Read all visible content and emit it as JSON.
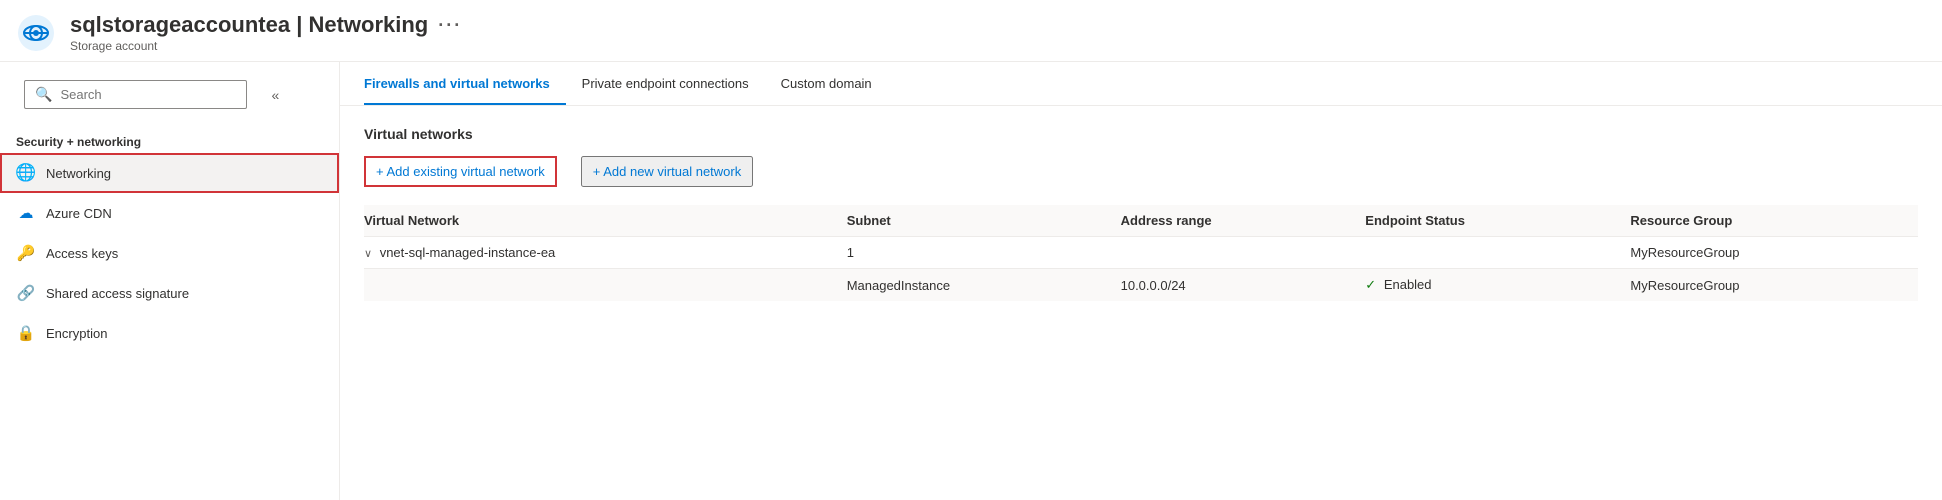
{
  "header": {
    "title": "sqlstorageaccountea | Networking",
    "resource_name": "sqlstorageaccountea",
    "page_name": "Networking",
    "subtitle": "Storage account",
    "dots": "···"
  },
  "sidebar": {
    "search_placeholder": "Search",
    "collapse_icon": "«",
    "section_label": "Security + networking",
    "items": [
      {
        "id": "networking",
        "label": "Networking",
        "icon": "🌐",
        "active": true
      },
      {
        "id": "azure-cdn",
        "label": "Azure CDN",
        "icon": "☁",
        "active": false
      },
      {
        "id": "access-keys",
        "label": "Access keys",
        "icon": "🔑",
        "active": false
      },
      {
        "id": "shared-access-signature",
        "label": "Shared access signature",
        "icon": "🔗",
        "active": false
      },
      {
        "id": "encryption",
        "label": "Encryption",
        "icon": "🔒",
        "active": false
      }
    ]
  },
  "tabs": [
    {
      "id": "firewalls",
      "label": "Firewalls and virtual networks",
      "active": true
    },
    {
      "id": "private-endpoints",
      "label": "Private endpoint connections",
      "active": false
    },
    {
      "id": "custom-domain",
      "label": "Custom domain",
      "active": false
    }
  ],
  "content": {
    "section_title": "Virtual networks",
    "add_existing_btn": "+ Add existing virtual network",
    "add_new_btn": "+ Add new virtual network",
    "table": {
      "columns": [
        "Virtual Network",
        "Subnet",
        "Address range",
        "Endpoint Status",
        "Resource Group"
      ],
      "rows": [
        {
          "virtual_network": "vnet-sql-managed-instance-ea",
          "subnet": "1",
          "address_range": "",
          "endpoint_status": "",
          "resource_group": "MyResourceGroup",
          "is_group": true
        },
        {
          "virtual_network": "",
          "subnet": "ManagedInstance",
          "address_range": "10.0.0.0/24",
          "endpoint_status": "✓ Enabled",
          "resource_group": "MyResourceGroup",
          "is_group": false
        }
      ]
    }
  }
}
